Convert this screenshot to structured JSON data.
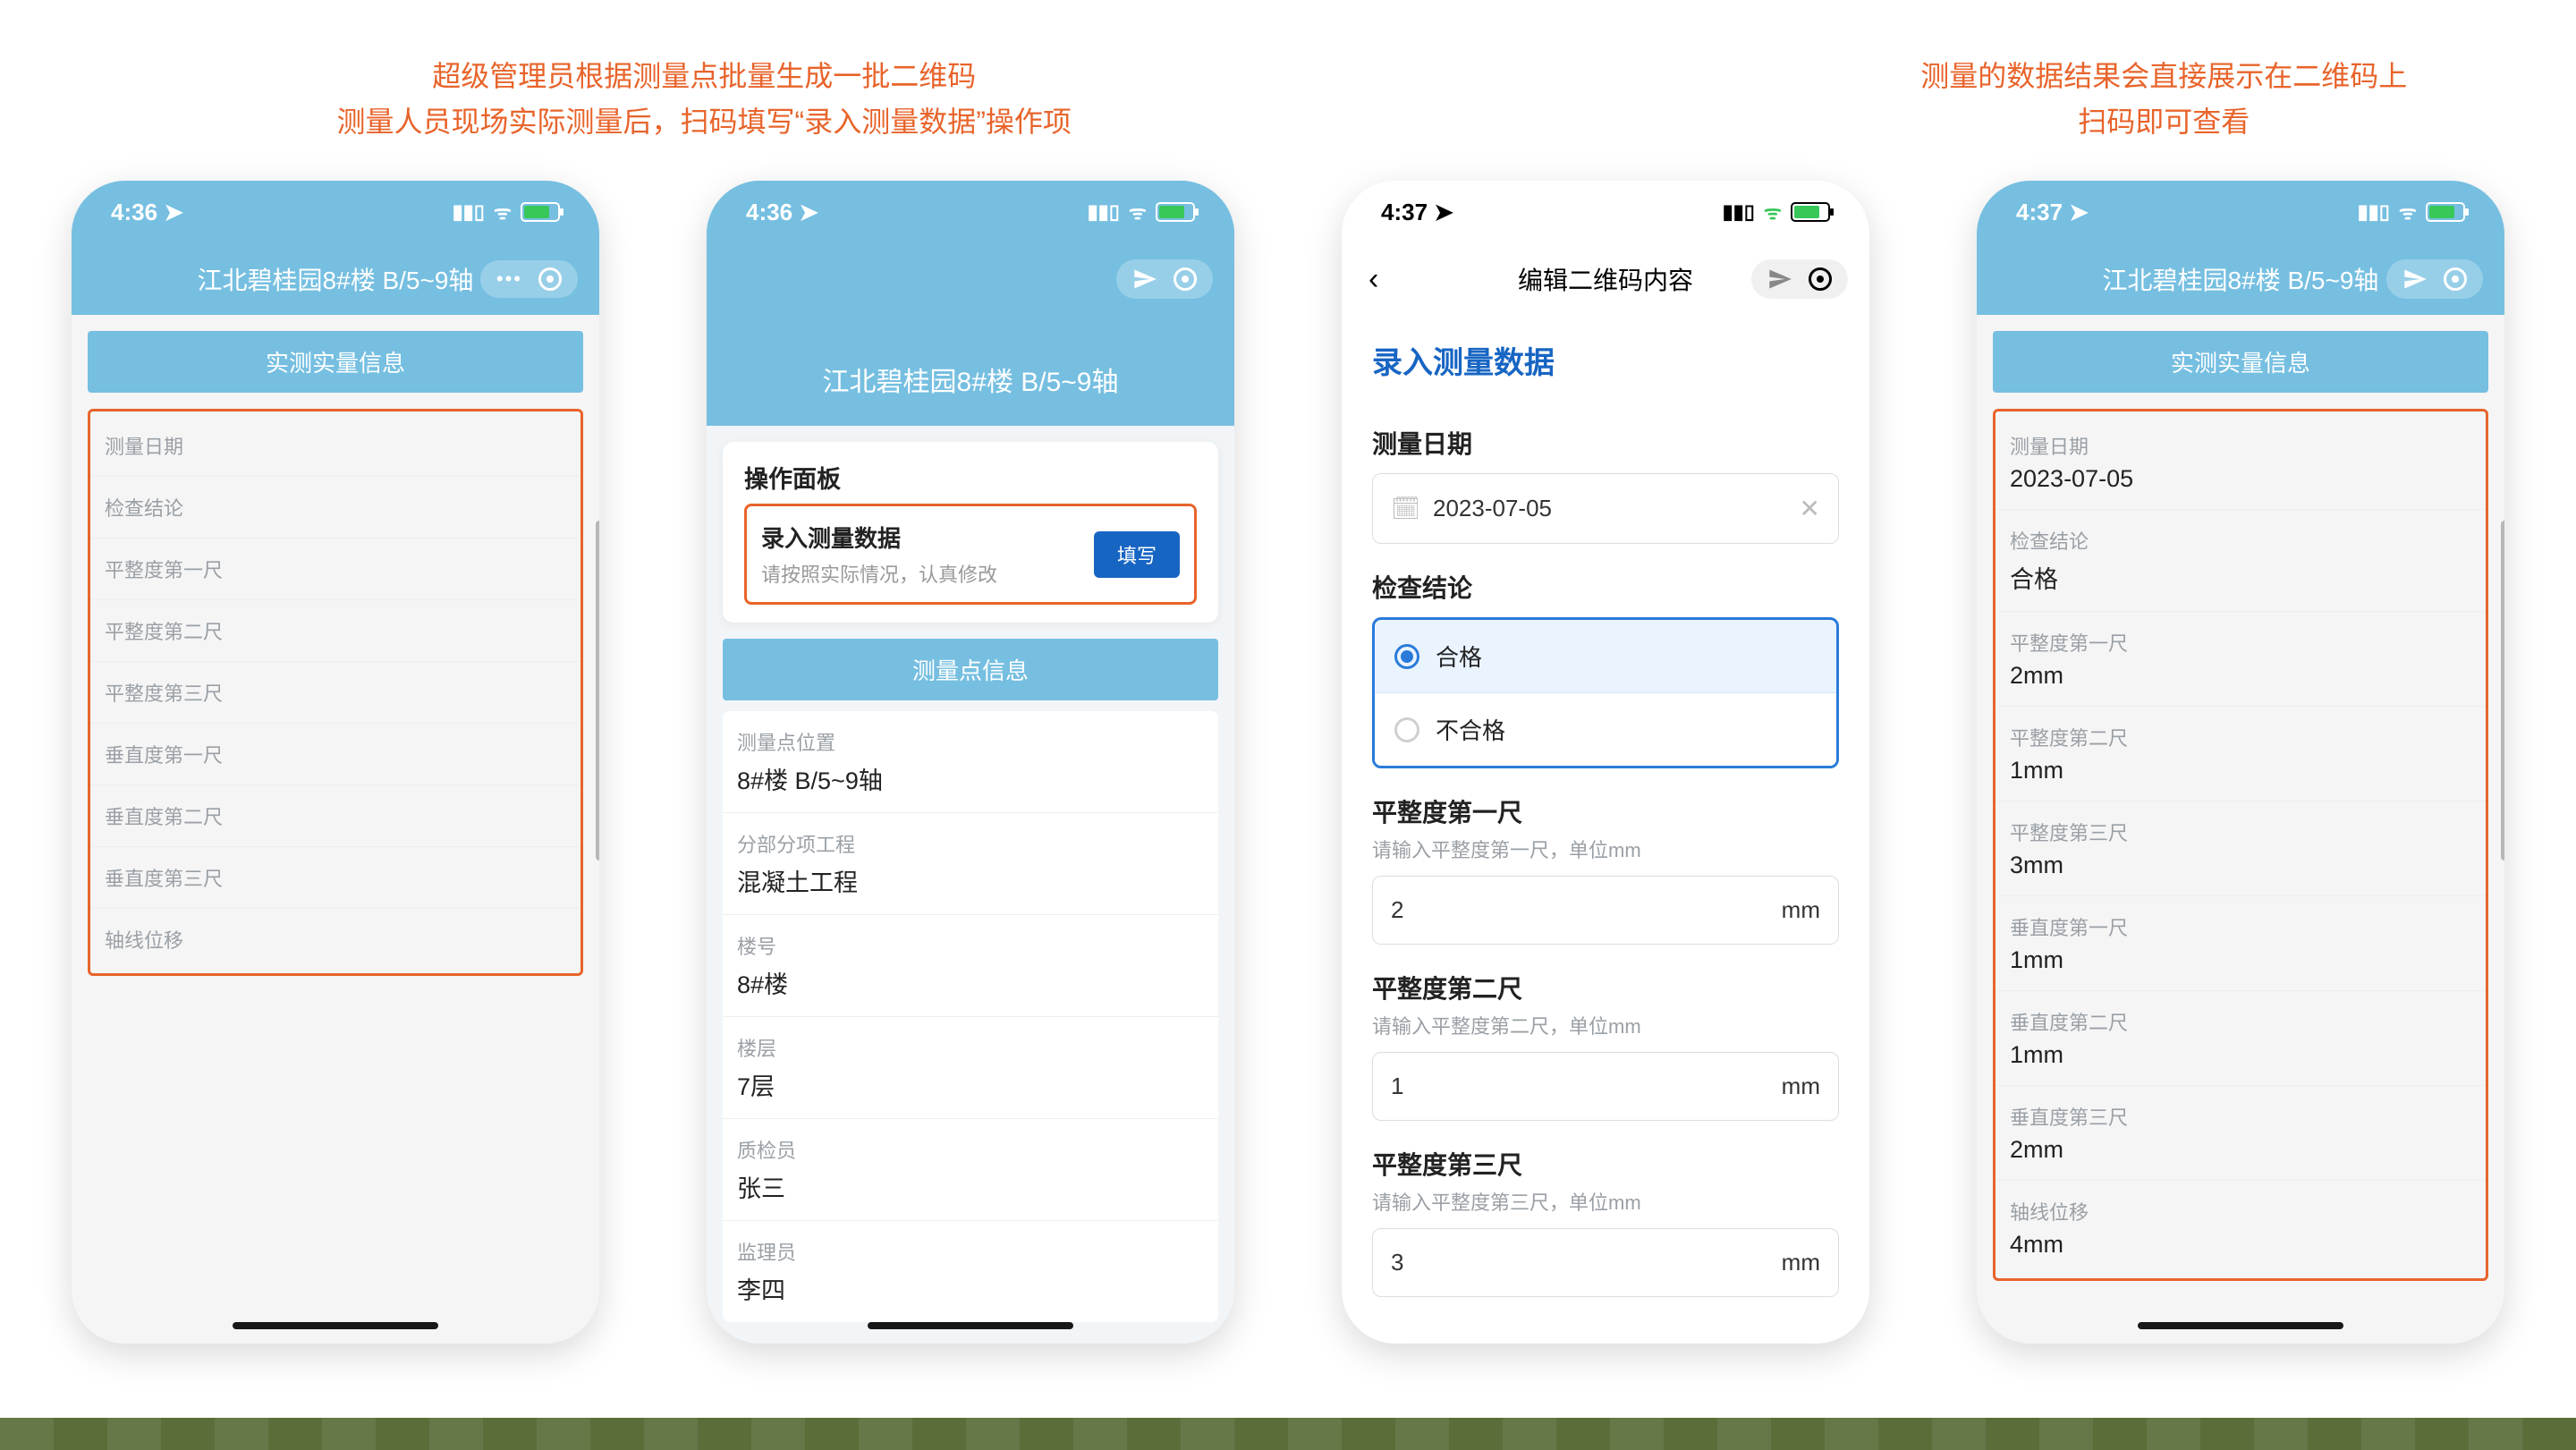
{
  "captions": {
    "left": "超级管理员根据测量点批量生成一批二维码\n测量人员现场实际测量后，扫码填写“录入测量数据”操作项",
    "right": "测量的数据结果会直接展示在二维码上\n扫码即可查看"
  },
  "status_time_a": "4:36",
  "status_time_b": "4:37",
  "screen1": {
    "title": "江北碧桂园8#楼 B/5~9轴",
    "tab": "实测实量信息",
    "fields": [
      "测量日期",
      "检查结论",
      "平整度第一尺",
      "平整度第二尺",
      "平整度第三尺",
      "垂直度第一尺",
      "垂直度第二尺",
      "垂直度第三尺",
      "轴线位移"
    ]
  },
  "screen2": {
    "title": "江北碧桂园8#楼 B/5~9轴",
    "panel_title": "操作面板",
    "action_title": "录入测量数据",
    "action_sub": "请按照实际情况，认真修改",
    "action_btn": "填写",
    "info_tab": "测量点信息",
    "rows": [
      {
        "label": "测量点位置",
        "value": "8#楼 B/5~9轴"
      },
      {
        "label": "分部分项工程",
        "value": "混凝土工程"
      },
      {
        "label": "楼号",
        "value": "8#楼"
      },
      {
        "label": "楼层",
        "value": "7层"
      },
      {
        "label": "质检员",
        "value": "张三"
      },
      {
        "label": "监理员",
        "value": "李四"
      }
    ]
  },
  "screen3": {
    "nav_title": "编辑二维码内容",
    "form_title": "录入测量数据",
    "date_label": "测量日期",
    "date_value": "2023-07-05",
    "conclusion_label": "检查结论",
    "opt_pass": "合格",
    "opt_fail": "不合格",
    "measures": [
      {
        "label": "平整度第一尺",
        "hint": "请输入平整度第一尺，单位mm",
        "value": "2"
      },
      {
        "label": "平整度第二尺",
        "hint": "请输入平整度第二尺，单位mm",
        "value": "1"
      },
      {
        "label": "平整度第三尺",
        "hint": "请输入平整度第三尺，单位mm",
        "value": "3"
      }
    ],
    "unit": "mm"
  },
  "screen4": {
    "title": "江北碧桂园8#楼 B/5~9轴",
    "tab": "实测实量信息",
    "rows": [
      {
        "label": "测量日期",
        "value": "2023-07-05"
      },
      {
        "label": "检查结论",
        "value": "合格"
      },
      {
        "label": "平整度第一尺",
        "value": "2mm"
      },
      {
        "label": "平整度第二尺",
        "value": "1mm"
      },
      {
        "label": "平整度第三尺",
        "value": "3mm"
      },
      {
        "label": "垂直度第一尺",
        "value": "1mm"
      },
      {
        "label": "垂直度第二尺",
        "value": "1mm"
      },
      {
        "label": "垂直度第三尺",
        "value": "2mm"
      },
      {
        "label": "轴线位移",
        "value": "4mm"
      }
    ]
  }
}
